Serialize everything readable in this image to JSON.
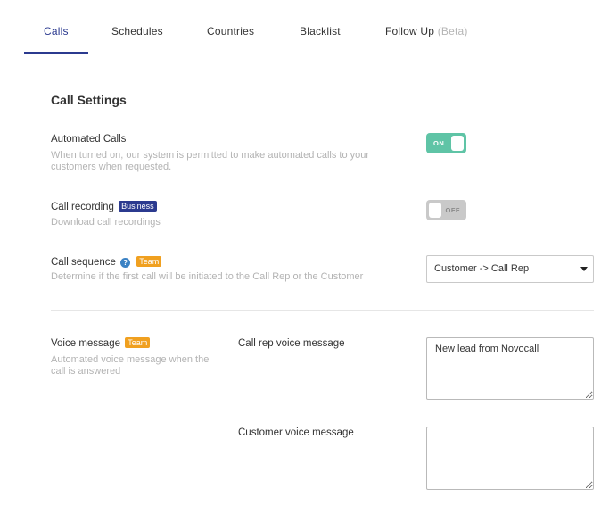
{
  "tabs": [
    {
      "label": "Calls",
      "active": true
    },
    {
      "label": "Schedules",
      "active": false
    },
    {
      "label": "Countries",
      "active": false
    },
    {
      "label": "Blacklist",
      "active": false
    },
    {
      "label": "Follow Up",
      "suffix": "(Beta)",
      "active": false
    }
  ],
  "section": {
    "title": "Call Settings"
  },
  "automated_calls": {
    "label": "Automated Calls",
    "description_line1": "When turned on, our system is permitted to make automated calls to your",
    "description_line2": "customers when requested.",
    "toggle_text": "ON",
    "enabled": true
  },
  "call_recording": {
    "label": "Call recording",
    "badge": "Business",
    "description": "Download call recordings",
    "toggle_text": "OFF",
    "enabled": false
  },
  "call_sequence": {
    "label": "Call sequence",
    "badge": "Team",
    "help_glyph": "?",
    "description": "Determine if the first call will be initiated to the Call Rep or the Customer",
    "selected": "Customer -> Call Rep"
  },
  "voice_message": {
    "label": "Voice message",
    "badge": "Team",
    "description_line1": "Automated voice message when the",
    "description_line2": "call is answered",
    "call_rep_label": "Call rep voice message",
    "call_rep_value": "New lead from Novocall",
    "customer_label": "Customer voice message",
    "customer_value": ""
  },
  "colors": {
    "accent": "#2b3a8f",
    "toggle_on": "#5fc4a6",
    "toggle_off": "#c9c9c9",
    "team_badge": "#f0a020",
    "business_badge": "#2b3a8f"
  },
  "icons": {
    "help": "help-icon",
    "select_caret": "chevron-down-icon"
  }
}
